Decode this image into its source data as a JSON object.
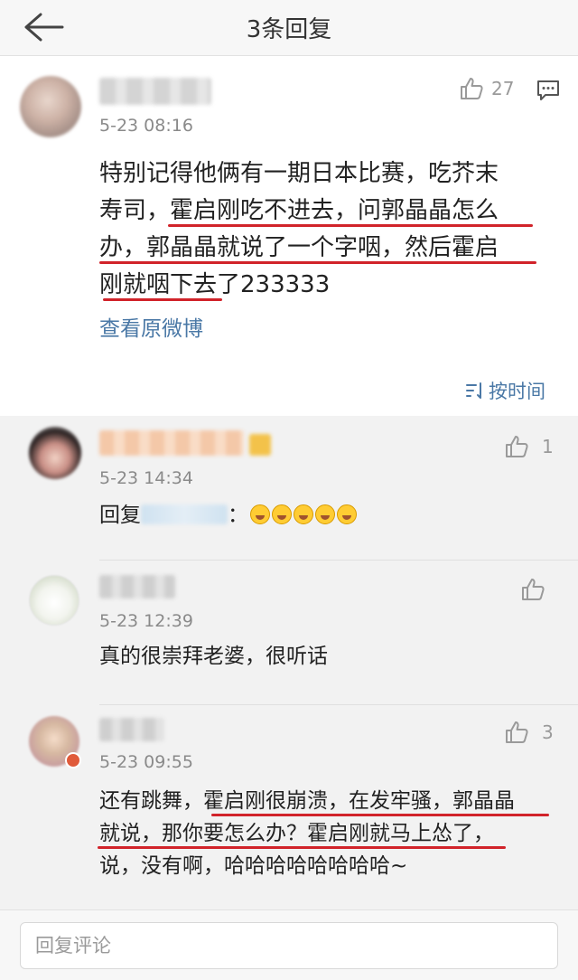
{
  "header": {
    "title": "3条回复",
    "back_icon": "arrow-left-icon"
  },
  "main_comment": {
    "time": "5-23 08:16",
    "likes": "27",
    "text_lines": [
      "特别记得他俩有一期日本比赛，吃芥末",
      "寿司，霍启刚吃不进去，问郭晶晶怎么",
      "办，郭晶晶就说了一个字咽，然后霍启",
      "刚就咽下去了233333"
    ],
    "view_original": "查看原微博",
    "sort_label": "按时间",
    "highlight_color": "#d1232a"
  },
  "replies": [
    {
      "time": "5-23 14:34",
      "likes": "1",
      "text_prefix": "回复",
      "text_suffix": "："
    },
    {
      "time": "5-23 12:39",
      "likes": "",
      "text": "真的很崇拜老婆，很听话"
    },
    {
      "time": "5-23 09:55",
      "likes": "3",
      "text_lines": [
        "还有跳舞，霍启刚很崩溃，在发牢骚，郭晶晶",
        "就说，那你要怎么办？霍启刚就马上怂了，",
        "说，没有啊，哈哈哈哈哈哈哈哈~"
      ]
    }
  ],
  "footer": {
    "input_placeholder": "回复评论"
  },
  "colors": {
    "link": "#4a78a6",
    "text": "#222222",
    "muted": "#8a8a8a"
  }
}
